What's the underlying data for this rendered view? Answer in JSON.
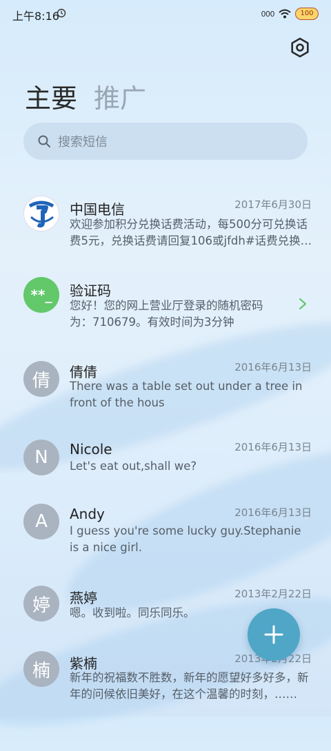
{
  "status": {
    "time": "上午8:16",
    "signal": "000",
    "battery": "100"
  },
  "tabs": {
    "main": "主要",
    "promo": "推广"
  },
  "search": {
    "placeholder": "搜索短信"
  },
  "conversations": [
    {
      "name": "中国电信",
      "date": "2017年6月30日",
      "preview": "欢迎参加积分兑换话费活动，每500分可兑换话费5元，兑换话费请回复106或jfdh#话费兑换面值……",
      "avatar": "telecom-logo-icon"
    },
    {
      "name": "验证码",
      "date": "",
      "preview": "您好！您的网上营业厅登录的随机密码为：710679。有效时间为3分钟",
      "avatar_text": "**_"
    },
    {
      "name": "倩倩",
      "date": "2016年6月13日",
      "preview": "There was a table set out under a tree in front of the hous",
      "avatar_text": "倩"
    },
    {
      "name": "Nicole",
      "date": "2016年6月13日",
      "preview": "Let's eat out,shall we?",
      "avatar_text": "N"
    },
    {
      "name": "Andy",
      "date": "2016年6月13日",
      "preview": "I guess you're some lucky guy.Stephanie is a nice girl.",
      "avatar_text": "A"
    },
    {
      "name": "燕婷",
      "date": "2013年2月22日",
      "preview": "嗯。收到啦。同乐同乐。",
      "avatar_text": "婷"
    },
    {
      "name": "紫楠",
      "date": "2013年2月22日",
      "preview": "新年的祝福数不胜数，新年的愿望好多好多，新年的问候依旧美好，在这个温馨的时刻，……",
      "avatar_text": "楠"
    }
  ],
  "colors": {
    "fab": "#4fa6c6",
    "verify_avatar": "#62c86a",
    "avatar_gray": "#a9b4c0"
  }
}
